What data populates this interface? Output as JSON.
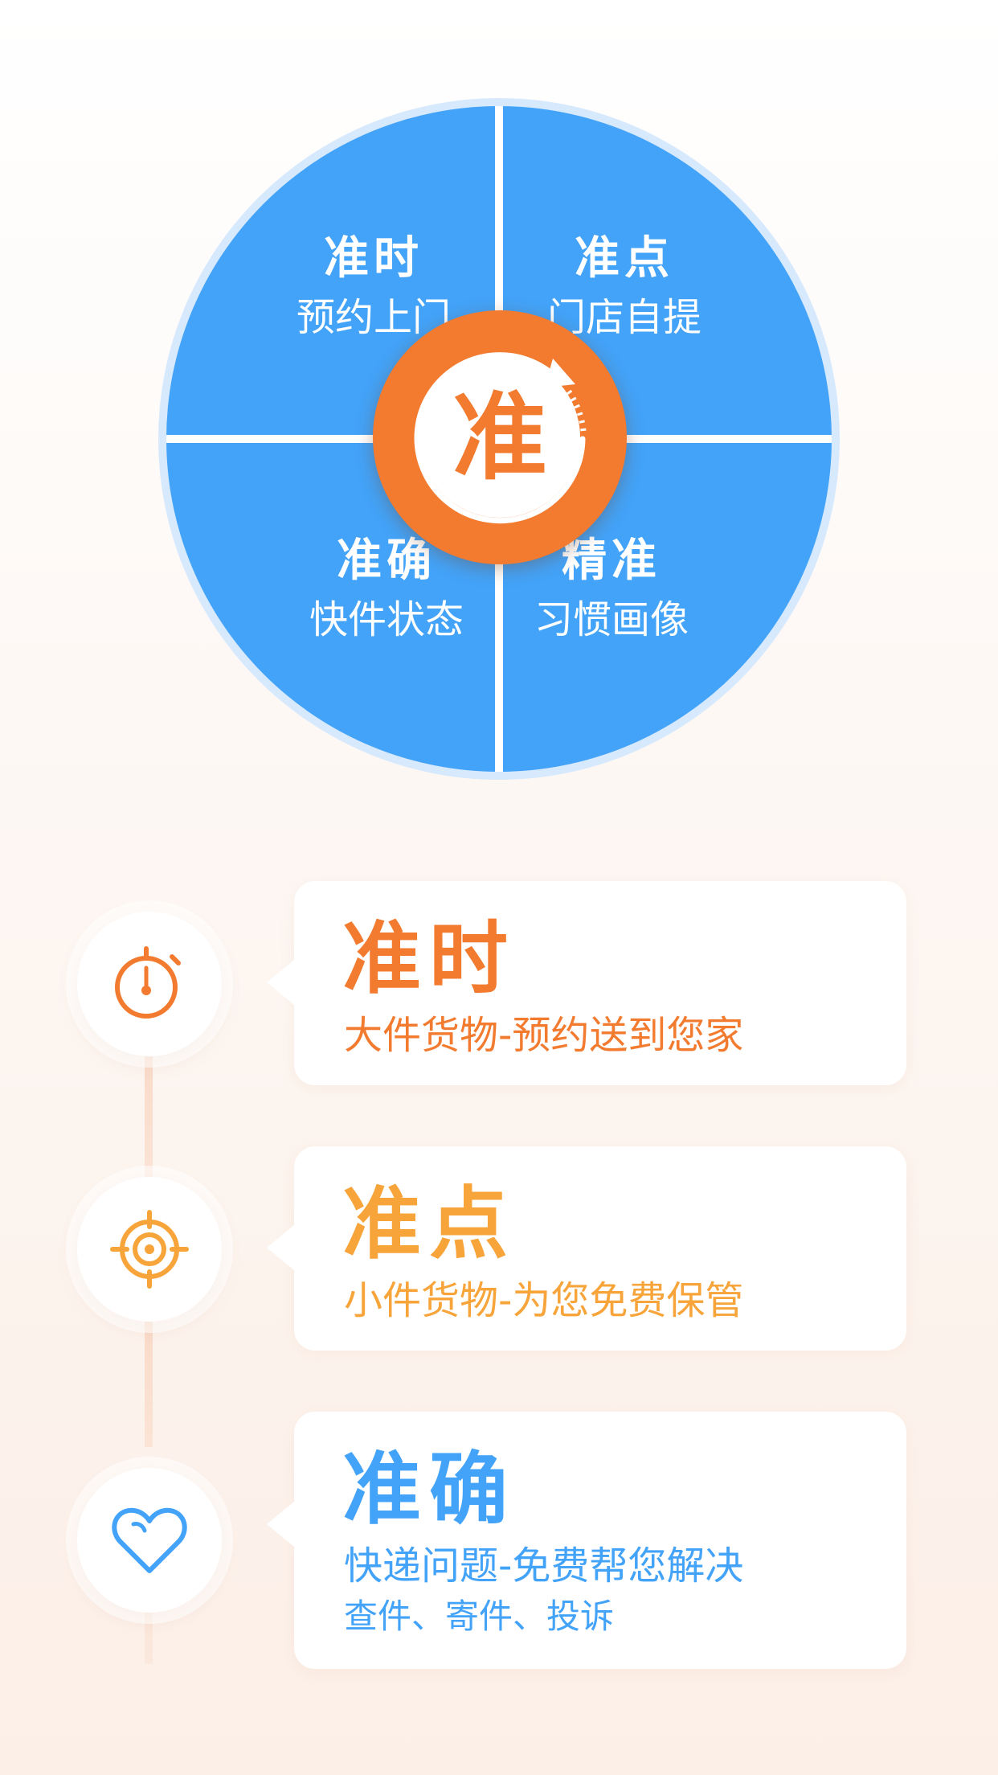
{
  "wheel": {
    "center_char": "准",
    "quadrants": [
      {
        "title": "准时",
        "subtitle": "预约上门"
      },
      {
        "title": "准点",
        "subtitle": "门店自提"
      },
      {
        "title": "准确",
        "subtitle": "快件状态"
      },
      {
        "title": "精准",
        "subtitle": "习惯画像"
      }
    ],
    "colors": {
      "wheel": "#43a3f8",
      "hub": "#f27b30"
    }
  },
  "features": [
    {
      "title": "准时",
      "subtitle": "大件货物-预约送到您家",
      "icon": "stopwatch-icon",
      "color": "#f27b30"
    },
    {
      "title": "准点",
      "subtitle": "小件货物-为您免费保管",
      "icon": "target-icon",
      "color": "#f7a43a"
    },
    {
      "title": "准确",
      "subtitle": "快递问题-免费帮您解决",
      "detail": "查件、寄件、投诉",
      "icon": "heart-icon",
      "color": "#43a3f8"
    }
  ]
}
